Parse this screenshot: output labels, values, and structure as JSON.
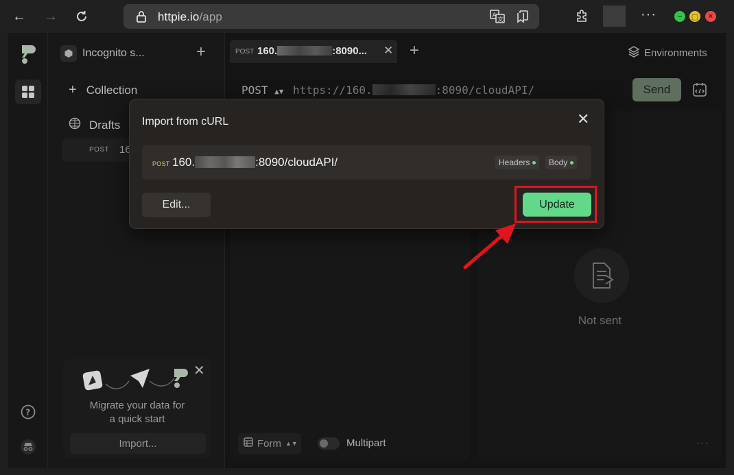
{
  "browser": {
    "url_host": "httpie.io",
    "url_path": "/app"
  },
  "sidebar": {
    "workspace": "Incognito s...",
    "collection_label": "Collection",
    "drafts_label": "Drafts",
    "draft_item": {
      "method": "POST",
      "url": "16"
    },
    "migrate": {
      "text_line1": "Migrate your data for",
      "text_line2": "a quick start",
      "import_label": "Import..."
    }
  },
  "tabs": [
    {
      "method": "POST",
      "url_prefix": "160.",
      "url_suffix": ":8090..."
    }
  ],
  "header": {
    "environments_label": "Environments"
  },
  "request": {
    "method": "POST",
    "url_prefix": "https://160.",
    "url_suffix": ":8090/cloudAPI/",
    "send_label": "Send"
  },
  "response": {
    "status_text": "Not sent"
  },
  "body_options": {
    "form_label": "Form",
    "multipart_label": "Multipart"
  },
  "modal": {
    "title": "Import from cURL",
    "method": "POST",
    "url_prefix": "160.",
    "url_suffix": ":8090/cloudAPI/",
    "badges": [
      "Headers",
      "Body"
    ],
    "edit_label": "Edit...",
    "update_label": "Update"
  },
  "colors": {
    "accent_green": "#62d98a",
    "highlight_red": "#e3141c",
    "method_yellow": "#d8cf63"
  }
}
